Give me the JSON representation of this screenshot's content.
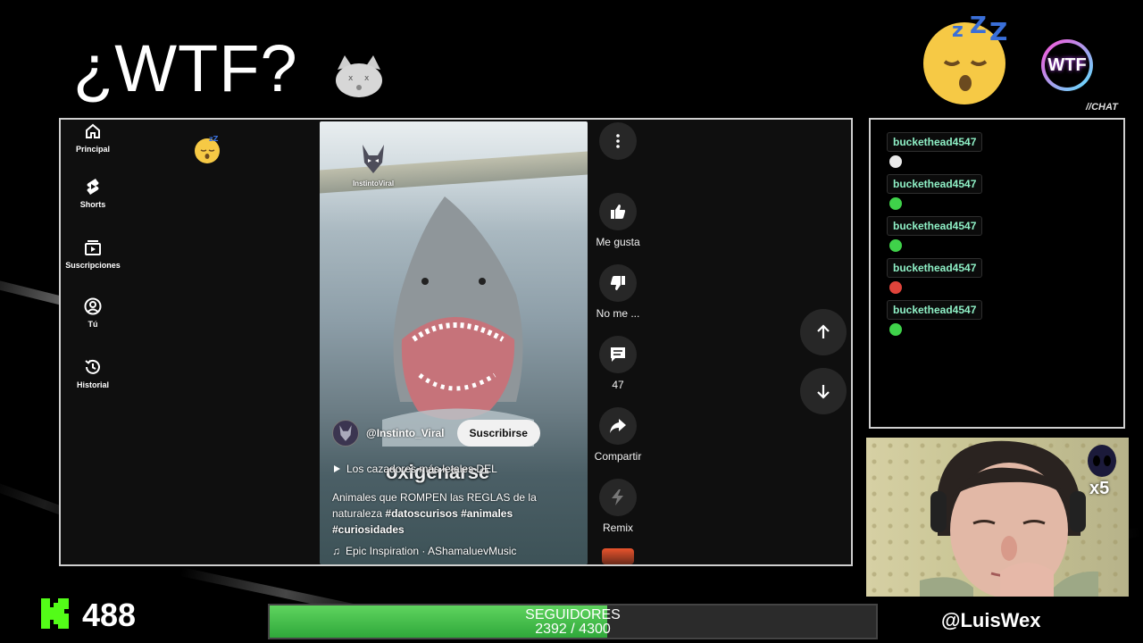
{
  "header": {
    "title": "¿WTF?",
    "logo_text": "WTF",
    "chat_label": "//CHAT"
  },
  "sidebar": {
    "items": [
      {
        "label": "Principal",
        "icon": "home-icon"
      },
      {
        "label": "Shorts",
        "icon": "shorts-icon"
      },
      {
        "label": "Suscripciones",
        "icon": "subscriptions-icon"
      },
      {
        "label": "Tú",
        "icon": "user-icon"
      },
      {
        "label": "Historial",
        "icon": "history-icon"
      }
    ]
  },
  "video": {
    "watermark": "InstintoViral",
    "overlay_caption": "oxigenarse",
    "channel": "@Instinto_Viral",
    "subscribe_label": "Suscribirse",
    "playlist": "Los cazadores más letales DEL",
    "description_plain": "Animales que ROMPEN las REGLAS de la naturaleza",
    "hashtags": [
      "#datoscurisos",
      "#animales",
      "#curiosidades"
    ],
    "music": "Epic Inspiration · AShamaluevMusic"
  },
  "actions": {
    "like": "Me gusta",
    "dislike": "No me ...",
    "comments": "47",
    "share": "Compartir",
    "remix": "Remix"
  },
  "chat": {
    "messages": [
      {
        "user": "buckethead4547",
        "emote_color": "#e9e9e9"
      },
      {
        "user": "buckethead4547",
        "emote_color": "#3fd24a"
      },
      {
        "user": "buckethead4547",
        "emote_color": "#3fd24a"
      },
      {
        "user": "buckethead4547",
        "emote_color": "#e0443b"
      },
      {
        "user": "buckethead4547",
        "emote_color": "#3fd24a"
      }
    ]
  },
  "webcam": {
    "multiplier": "x5"
  },
  "footer": {
    "kick_count": "488",
    "goal_label": "SEGUIDORES",
    "goal_progress": "2392 / 4300",
    "goal_fraction": 0.556,
    "handle": "@LuisWex"
  },
  "colors": {
    "chat_user": "#8ff0c6",
    "kick_green": "#53fc18",
    "progress_green": "#3fb844"
  }
}
